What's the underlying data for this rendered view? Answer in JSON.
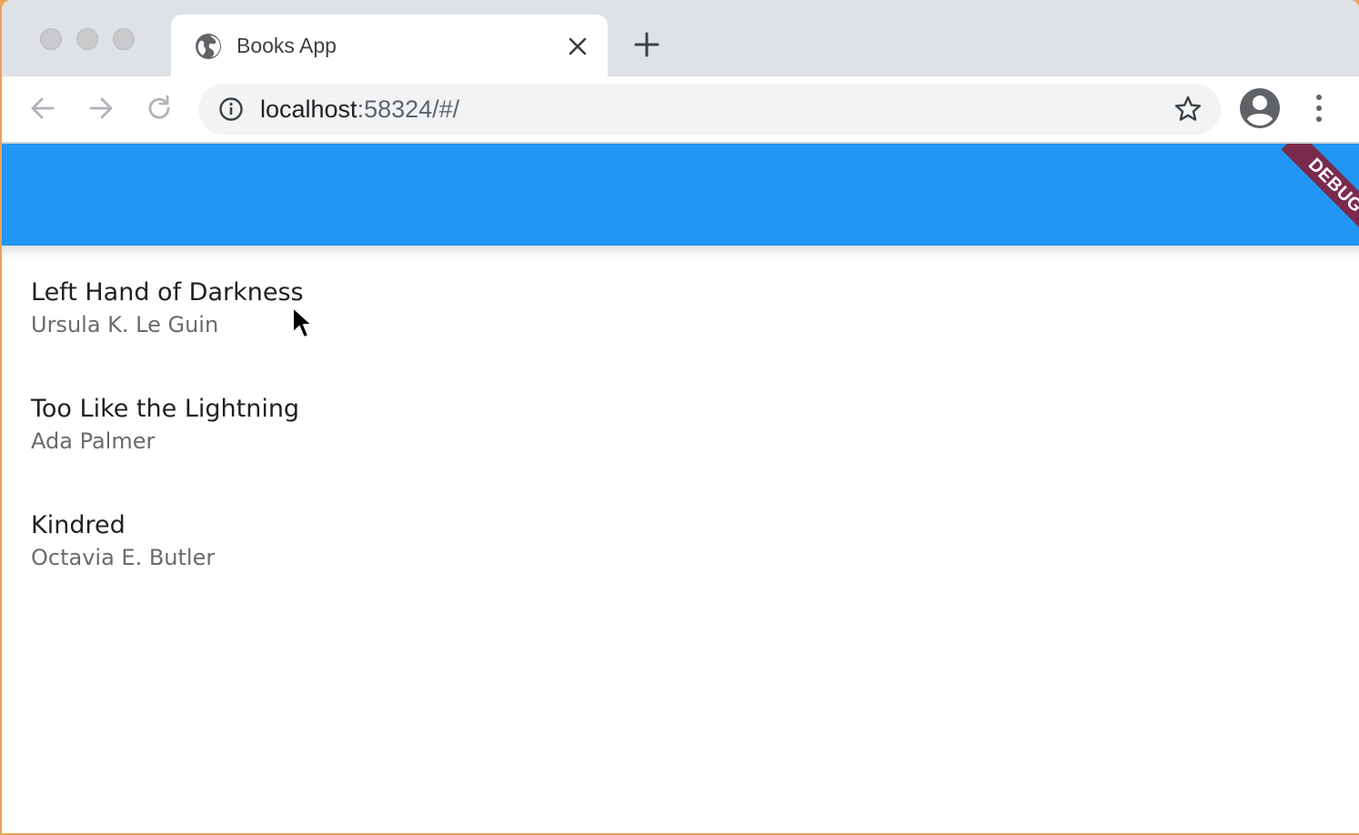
{
  "browser": {
    "tab": {
      "title": "Books App",
      "favicon": "globe-icon"
    },
    "address_bar": {
      "host": "localhost",
      "rest": ":58324/#/"
    },
    "icons": {
      "close": "close-icon",
      "new_tab": "plus-icon",
      "back": "arrow-left-icon",
      "forward": "arrow-right-icon",
      "reload": "reload-icon",
      "info": "info-icon",
      "bookmark": "star-icon",
      "profile": "avatar-icon",
      "menu": "kebab-menu-icon"
    }
  },
  "app": {
    "appbar_color": "#2196f3",
    "debug_banner": "DEBUG",
    "books": [
      {
        "title": "Left Hand of Darkness",
        "author": "Ursula K. Le Guin"
      },
      {
        "title": "Too Like the Lightning",
        "author": "Ada Palmer"
      },
      {
        "title": "Kindred",
        "author": "Octavia E. Butler"
      }
    ]
  }
}
